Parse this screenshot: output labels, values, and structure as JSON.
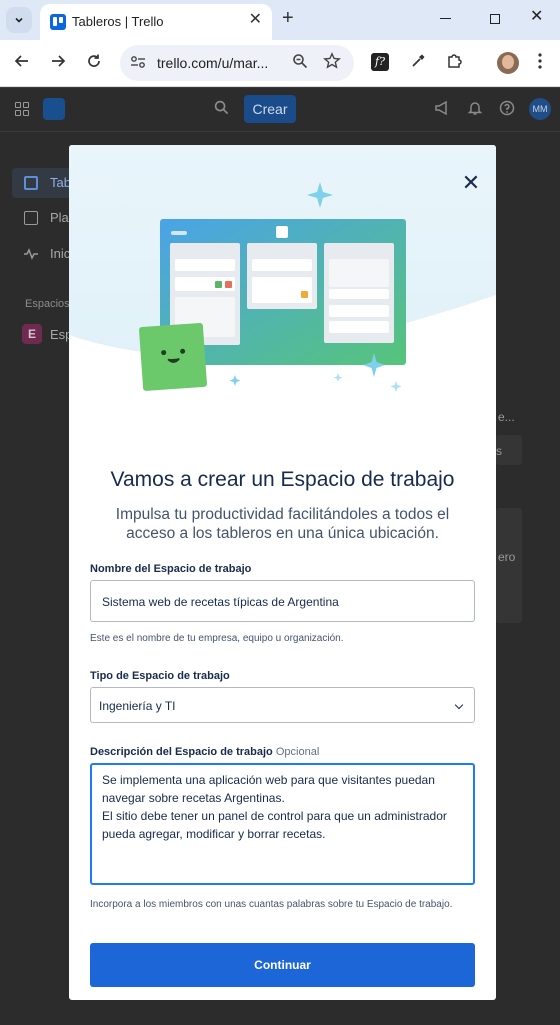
{
  "browser": {
    "tab_title": "Tableros | Trello",
    "url": "trello.com/u/mar...",
    "tab_close": "✕",
    "new_tab": "+",
    "win_close": "✕"
  },
  "trello": {
    "create_button": "Crear",
    "member_initials": "MM",
    "sidebar": [
      {
        "label": "Table"
      },
      {
        "label": "Pla"
      },
      {
        "label": "Inic"
      }
    ],
    "spaces_label": "Espacios",
    "workspace_letter": "E",
    "workspace_label": "Esp",
    "peek_1": "e...",
    "peek_2": "s",
    "peek_3": "ero"
  },
  "modal": {
    "close": "✕",
    "title": "Vamos a crear un Espacio de trabajo",
    "subtitle": "Impulsa tu productividad facilitándoles a todos el acceso a los tableros en una única ubicación.",
    "name_label": "Nombre del Espacio de trabajo",
    "name_value": "Sistema web de recetas típicas de Argentina",
    "name_help": "Este es el nombre de tu empresa, equipo u organización.",
    "type_label": "Tipo de Espacio de trabajo",
    "type_value": "Ingeniería y TI",
    "desc_label": "Descripción del Espacio de trabajo",
    "desc_optional": "Opcional",
    "desc_value": "Se implementa una aplicación web para que visitantes puedan navegar sobre recetas Argentinas.\nEl sitio debe tener un panel de control para que un administrador pueda agregar, modificar y borrar recetas.",
    "desc_help": "Incorpora a los miembros con unas cuantas palabras sobre tu Espacio de trabajo.",
    "continue_button": "Continuar"
  },
  "colors": {
    "accent": "#1d66d8",
    "focus": "#1d7afc",
    "text": "#172b4d"
  }
}
